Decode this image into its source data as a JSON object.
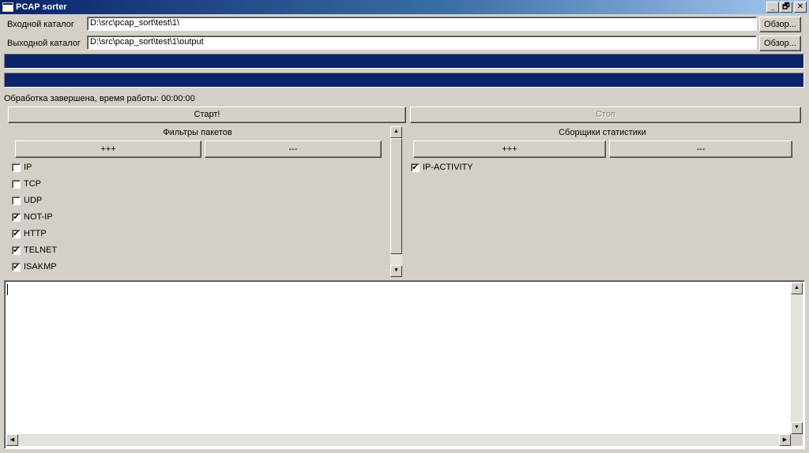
{
  "window": {
    "title": "PCAP sorter",
    "buttons": {
      "minimize": "_",
      "restore": "🗗",
      "close": "✕"
    }
  },
  "input_dir": {
    "label": "Входной каталог",
    "value": "D:\\src\\pcap_sort\\test\\1\\",
    "browse_label": "Обзор..."
  },
  "output_dir": {
    "label": "Выходной каталог",
    "value": "D:\\src\\pcap_sort\\test\\1\\output",
    "browse_label": "Обзор..."
  },
  "progress": {
    "first": 1.0,
    "second": 1.0
  },
  "status_text": "Обработка завершена, время работы: 00:00:00",
  "actions": {
    "start_label": "Старт!",
    "stop_label": "Стоп"
  },
  "filters": {
    "title": "Фильтры пакетов",
    "add_label": "+++",
    "remove_label": "---",
    "items": [
      {
        "label": "IP",
        "checked": false
      },
      {
        "label": "TCP",
        "checked": false
      },
      {
        "label": "UDP",
        "checked": false
      },
      {
        "label": "NOT-IP",
        "checked": true
      },
      {
        "label": "HTTP",
        "checked": true
      },
      {
        "label": "TELNET",
        "checked": true
      },
      {
        "label": "ISAKMP",
        "checked": true
      }
    ]
  },
  "collectors": {
    "title": "Сборщики статистики",
    "add_label": "+++",
    "remove_label": "---",
    "items": [
      {
        "label": "IP-ACTIVITY",
        "checked": true
      }
    ]
  },
  "log": {
    "value": ""
  },
  "icons": {
    "scroll_up": "▲",
    "scroll_down": "▼",
    "scroll_left": "◀",
    "scroll_right": "▶",
    "check": "✔"
  }
}
